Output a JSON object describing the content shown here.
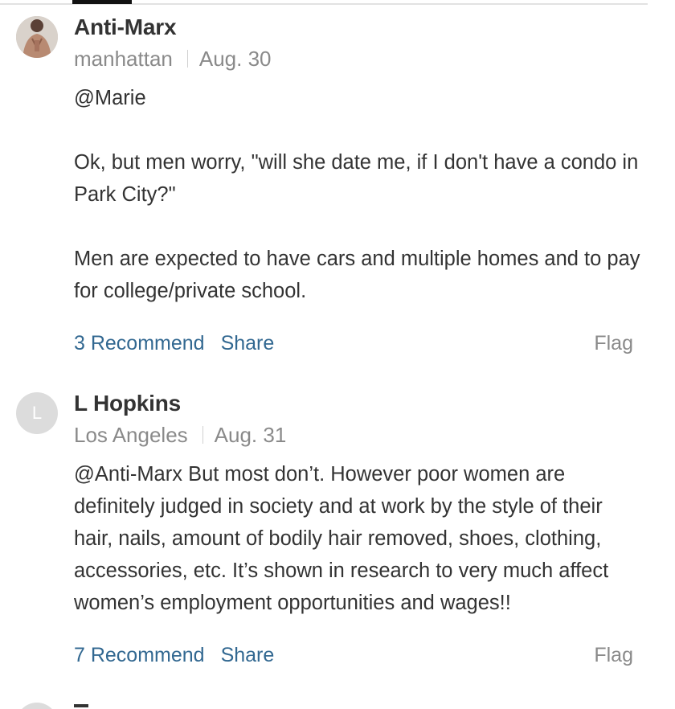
{
  "comments": [
    {
      "author": "Anti-Marx",
      "location": "manhattan",
      "date": "Aug. 30",
      "paragraphs": [
        "@Marie",
        "Ok, but men worry, \"will she date me, if I don't have a condo in Park City?\"",
        "Men are expected to have cars and multiple homes and to pay for college/private school."
      ],
      "recommend_label": "3 Recommend",
      "share_label": "Share",
      "flag_label": "Flag"
    },
    {
      "author": "L Hopkins",
      "avatar_initial": "L",
      "location": "Los Angeles",
      "date": "Aug. 31",
      "paragraphs": [
        "@Anti-Marx But most don’t. However poor women are definitely judged in society and at work by the style of their hair, nails, amount of bodily hair removed, shoes, clothing, accessories, etc. It’s shown in research to very much affect women’s employment opportunities and wages!!"
      ],
      "recommend_label": "7 Recommend",
      "share_label": "Share",
      "flag_label": "Flag"
    }
  ],
  "colors": {
    "link": "#326891",
    "muted": "#8a8a8a",
    "text": "#333333"
  }
}
